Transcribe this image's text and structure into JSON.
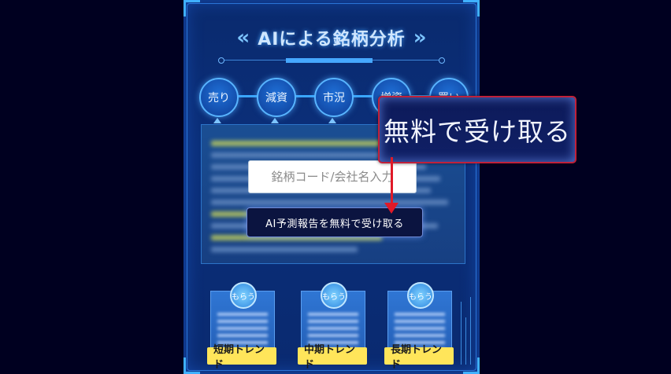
{
  "header": {
    "title": "AIによる銘柄分析",
    "left_icon": "chevron-left-double-icon",
    "right_icon": "chevron-right-double-icon"
  },
  "tabs": [
    {
      "label": "売り"
    },
    {
      "label": "減資"
    },
    {
      "label": "市況"
    },
    {
      "label": "増資"
    },
    {
      "label": "買い"
    }
  ],
  "search": {
    "placeholder": "銘柄コード/会社名入力"
  },
  "cta": {
    "label": "AI予測報告を無料で受け取る"
  },
  "cards": [
    {
      "badge": "もらう",
      "label": "短期トレンド"
    },
    {
      "badge": "もらう",
      "label": "中期トレンド"
    },
    {
      "badge": "もらう",
      "label": "長期トレンド"
    }
  ],
  "zoom_callout": {
    "text": "無料で受け取る"
  },
  "colors": {
    "background": "#000020",
    "panel": "#0a2a6e",
    "accent": "#46a8ff",
    "label_yellow": "#ffe55a",
    "callout_border": "#c0203a",
    "arrow": "#e01a28"
  }
}
